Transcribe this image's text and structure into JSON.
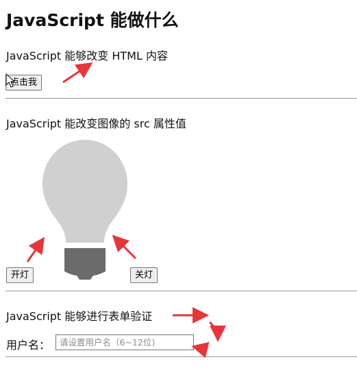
{
  "page": {
    "title": "JavaScript 能做什么"
  },
  "section1": {
    "text": "JavaScript 能够改变 HTML 内容",
    "button_label": "点击我"
  },
  "section2": {
    "text": "JavaScript 能改变图像的 src 属性值",
    "on_button_label": "开灯",
    "off_button_label": "关灯",
    "bulb_state": "off",
    "colors": {
      "bulb_glass": "#d0d0d0",
      "bulb_base": "#6b6b6b"
    }
  },
  "section3": {
    "text": "JavaScript 能够进行表单验证",
    "username_label": "用户名：",
    "username_placeholder": "请设置用户名（6~12位)",
    "username_value": ""
  },
  "annotations": {
    "arrow_color": "#e8353a"
  }
}
